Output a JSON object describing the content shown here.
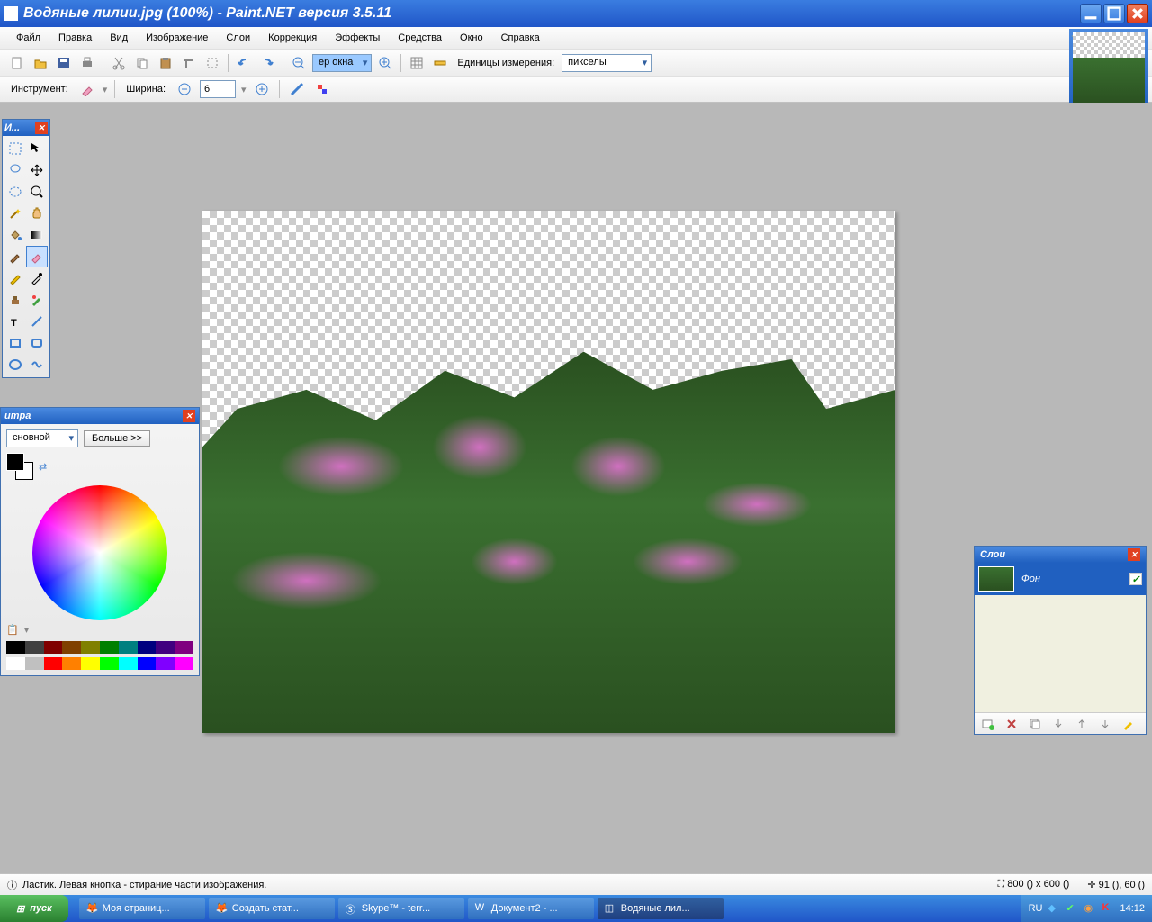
{
  "title": "Водяные лилии.jpg (100%) - Paint.NET версия 3.5.11",
  "menu": [
    "Файл",
    "Правка",
    "Вид",
    "Изображение",
    "Слои",
    "Коррекция",
    "Эффекты",
    "Средства",
    "Окно",
    "Справка"
  ],
  "toolbar": {
    "zoom_value": "ер окна",
    "units_label": "Единицы измерения:",
    "units_value": "пикселы"
  },
  "toolbar2": {
    "tool_label": "Инструмент:",
    "width_label": "Ширина:",
    "width_value": "6"
  },
  "tools_win": {
    "title": "И..."
  },
  "colors_win": {
    "title": "итра",
    "mode": "сновной",
    "more": "Больше >>"
  },
  "layers_win": {
    "title": "Слои",
    "layer1": "Фон"
  },
  "status": {
    "hint": "Ластик. Левая кнопка - стирание части изображения.",
    "size": "800 () x 600 ()",
    "pos": "91 (), 60 ()"
  },
  "taskbar": {
    "start": "пуск",
    "items": [
      "Моя страниц...",
      "Создать стат...",
      "Skype™ - terr...",
      "Документ2 - ...",
      "Водяные лил..."
    ],
    "lang": "RU",
    "time": "14:12"
  },
  "palette_colors": [
    "#000",
    "#404040",
    "#800000",
    "#804000",
    "#808000",
    "#008000",
    "#008080",
    "#000080",
    "#400080",
    "#800080",
    "#fff",
    "#c0c0c0",
    "#f00",
    "#ff8000",
    "#ff0",
    "#0f0",
    "#0ff",
    "#00f",
    "#8000ff",
    "#f0f"
  ]
}
